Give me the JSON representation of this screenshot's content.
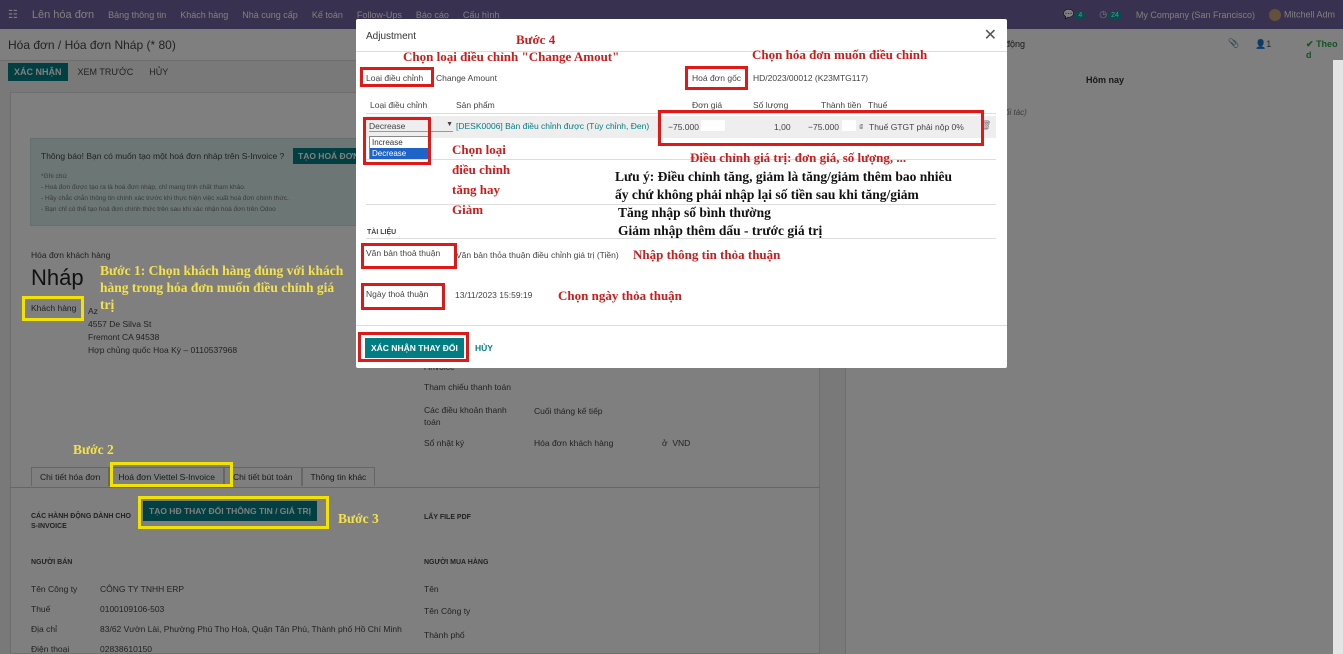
{
  "topbar": {
    "app": "Lên hóa đơn",
    "menu": [
      "Bảng thông tin",
      "Khách hàng",
      "Nhà cung cấp",
      "Kế toán",
      "Follow-Ups",
      "Báo cáo",
      "Cấu hình"
    ],
    "chat_count": "4",
    "activity_count": "24",
    "company": "My Company (San Francisco)",
    "user": "Mitchell Adm"
  },
  "breadcrumb": "Hóa đơn / Hóa đơn Nháp (* 80)",
  "buttons": {
    "confirm": "XÁC NHẬN",
    "preview": "XEM TRƯỚC",
    "cancel": "HỦY"
  },
  "chatter": {
    "activity": "động",
    "followers": "1",
    "follow": "Theo d",
    "today": "Hôm nay",
    "partner_note": "ối tác)"
  },
  "notice": {
    "text": "Thông báo! Bạn có muốn tạo một hoá đơn nháp trên S-Invoice ?",
    "button": "TẠO HOÁ ĐƠN",
    "notes": [
      "*Ghi chú:",
      "- Hoá đơn được tạo ra là hoá đơn nháp, chỉ mang tính chất tham khảo.",
      "- Hãy chắc chắn thông tin chính xác trước khi thực hiện việc xuất hoá đơn chính thức.",
      "- Bạn chỉ có thể tạo hoá đơn chính thức trên sau khi xác nhận hoá đơn trên Odoo"
    ]
  },
  "invoice": {
    "type": "Hóa đơn khách hàng",
    "status": "Nháp",
    "customer_label": "Khách hàng",
    "addr": [
      "Az",
      "4557 De Silva St",
      "Fremont CA 94538",
      "Hợp chủng quốc Hoa Kỳ – 0110537968"
    ]
  },
  "fields": [
    {
      "label": "Tham chiếu thanh toán",
      "value": ""
    },
    {
      "label": "Các điều khoản thanh toán",
      "value": "Cuối tháng kế tiếp"
    },
    {
      "label": "Sổ nhật ký",
      "value": "Hóa đơn khách hàng"
    }
  ],
  "partial_label": "i invoice",
  "journal_currency": "VND",
  "tabs": [
    "Chi tiết hóa đơn",
    "Hoá đơn Viettel S-Invoice",
    "Chi tiết bút toán",
    "Thông tin khác"
  ],
  "sinvoice": {
    "actions_title": "CÁC HÀNH ĐỘNG DÀNH CHO S-INVOICE",
    "create_btn": "TẠO HĐ THAY ĐỔI THÔNG TIN / GIÁ TRỊ",
    "pdf_title": "LẤY FILE PDF",
    "seller_title": "NGƯỜI BÁN",
    "buyer_title": "NGƯỜI MUA HÀNG",
    "seller": [
      {
        "label": "Tên Công ty",
        "value": "CÔNG TY TNHH ERP"
      },
      {
        "label": "Thuế",
        "value": "0100109106-503"
      },
      {
        "label": "Địa chỉ",
        "value": "83/62 Vườn Lài, Phường Phú Thọ Hoà, Quận Tân Phú, Thành phố Hồ Chí Minh"
      },
      {
        "label": "Điện thoại",
        "value": "02838610150"
      }
    ],
    "buyer": [
      "Tên",
      "Tên Công ty",
      "Thành phố"
    ]
  },
  "modal": {
    "title": "Adjustment",
    "adj_type_label": "Loại điều chỉnh",
    "adj_type_value": "Change Amount",
    "orig_label": "Hoá đơn gốc",
    "orig_value": "HD/2023/00012 (K23MTG117)",
    "cols": [
      "Loại điều chỉnh",
      "Sản phẩm",
      "Đơn giá",
      "Số lượng",
      "Thành tiền",
      "Thuế"
    ],
    "row": {
      "type": "Decrease",
      "product": "[DESK0006] Bàn điều chỉnh được (Tùy chỉnh, Đen)",
      "price": "−75.000",
      "qty": "1,00",
      "subtotal": "−75.000",
      "currency": "₫",
      "tax": "Thuế GTGT phải nộp 0%"
    },
    "options": [
      "Increase",
      "Decrease"
    ],
    "docs_title": "TÀI LIỆU",
    "agreement_label": "Văn bản thoả thuận",
    "agreement_value": "Văn bản thỏa thuận điều chỉnh giá trị (Tiền)",
    "date_label": "Ngày thoả thuận",
    "date_value": "13/11/2023 15:59:19",
    "confirm": "XÁC NHẬN THAY ĐỔI",
    "cancel": "HỦY"
  },
  "annotations": {
    "step4": "Bước 4",
    "step4_desc": "Chọn loại điều chỉnh \"Change Amout\"",
    "pick_invoice": "Chọn hóa đơn muốn điều chỉnh",
    "pick_type": "Chọn loại điều chỉnh tăng hay Giảm",
    "adjust_values": "Điều chỉnh giá trị: đơn giá, số lượng, ...",
    "note1": "Lưu ý: Điều chỉnh tăng, giảm là tăng/giảm thêm bao nhiêu",
    "note2": "ấy chứ không phải nhập lại số tiền sau khi tăng/giảm",
    "note3": "Tăng nhập số bình thường",
    "note4": "Giảm nhập thêm dấu - trước giá trị",
    "agreement": "Nhập thông tin thỏa thuận",
    "date": "Chọn ngày thỏa thuận",
    "step1": "Bước 1: Chọn khách hàng đúng với khách hàng trong hóa đơn muốn điều chỉnh giá trị",
    "step2": "Bước 2",
    "step3": "Bước 3"
  }
}
